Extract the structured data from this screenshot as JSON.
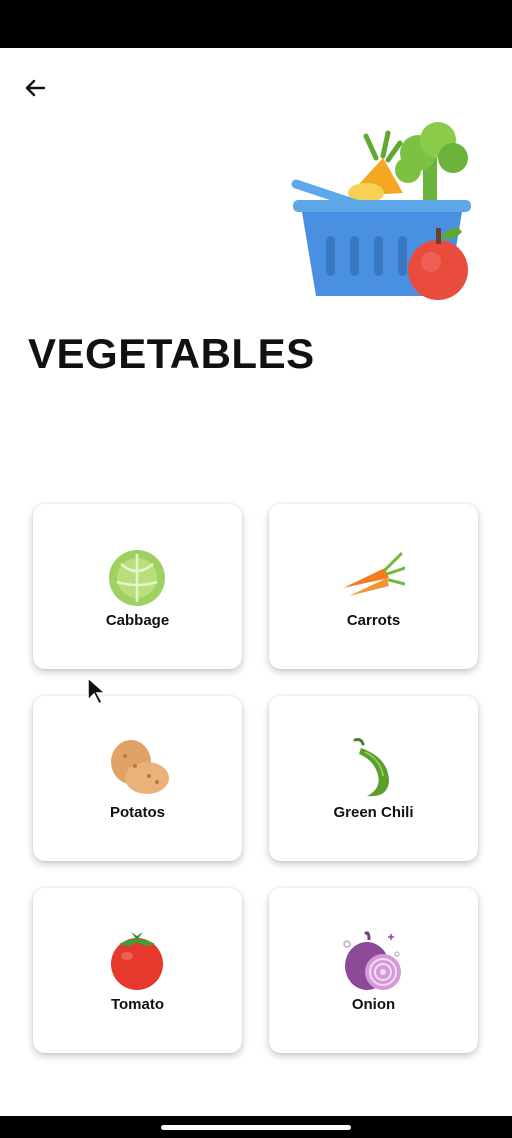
{
  "header": {
    "title": "VEGETABLES",
    "back_icon": "arrow-left-icon",
    "hero_icon": "vegetable-basket-icon"
  },
  "items": [
    {
      "label": "Cabbage",
      "icon": "cabbage-icon"
    },
    {
      "label": "Carrots",
      "icon": "carrot-icon"
    },
    {
      "label": "Potatos",
      "icon": "potato-icon"
    },
    {
      "label": "Green Chili",
      "icon": "green-chili-icon"
    },
    {
      "label": "Tomato",
      "icon": "tomato-icon"
    },
    {
      "label": "Onion",
      "icon": "onion-icon"
    }
  ],
  "colors": {
    "background": "#ffffff",
    "title": "#111111",
    "card": "#ffffff",
    "basket_blue": "#4a90e2"
  }
}
